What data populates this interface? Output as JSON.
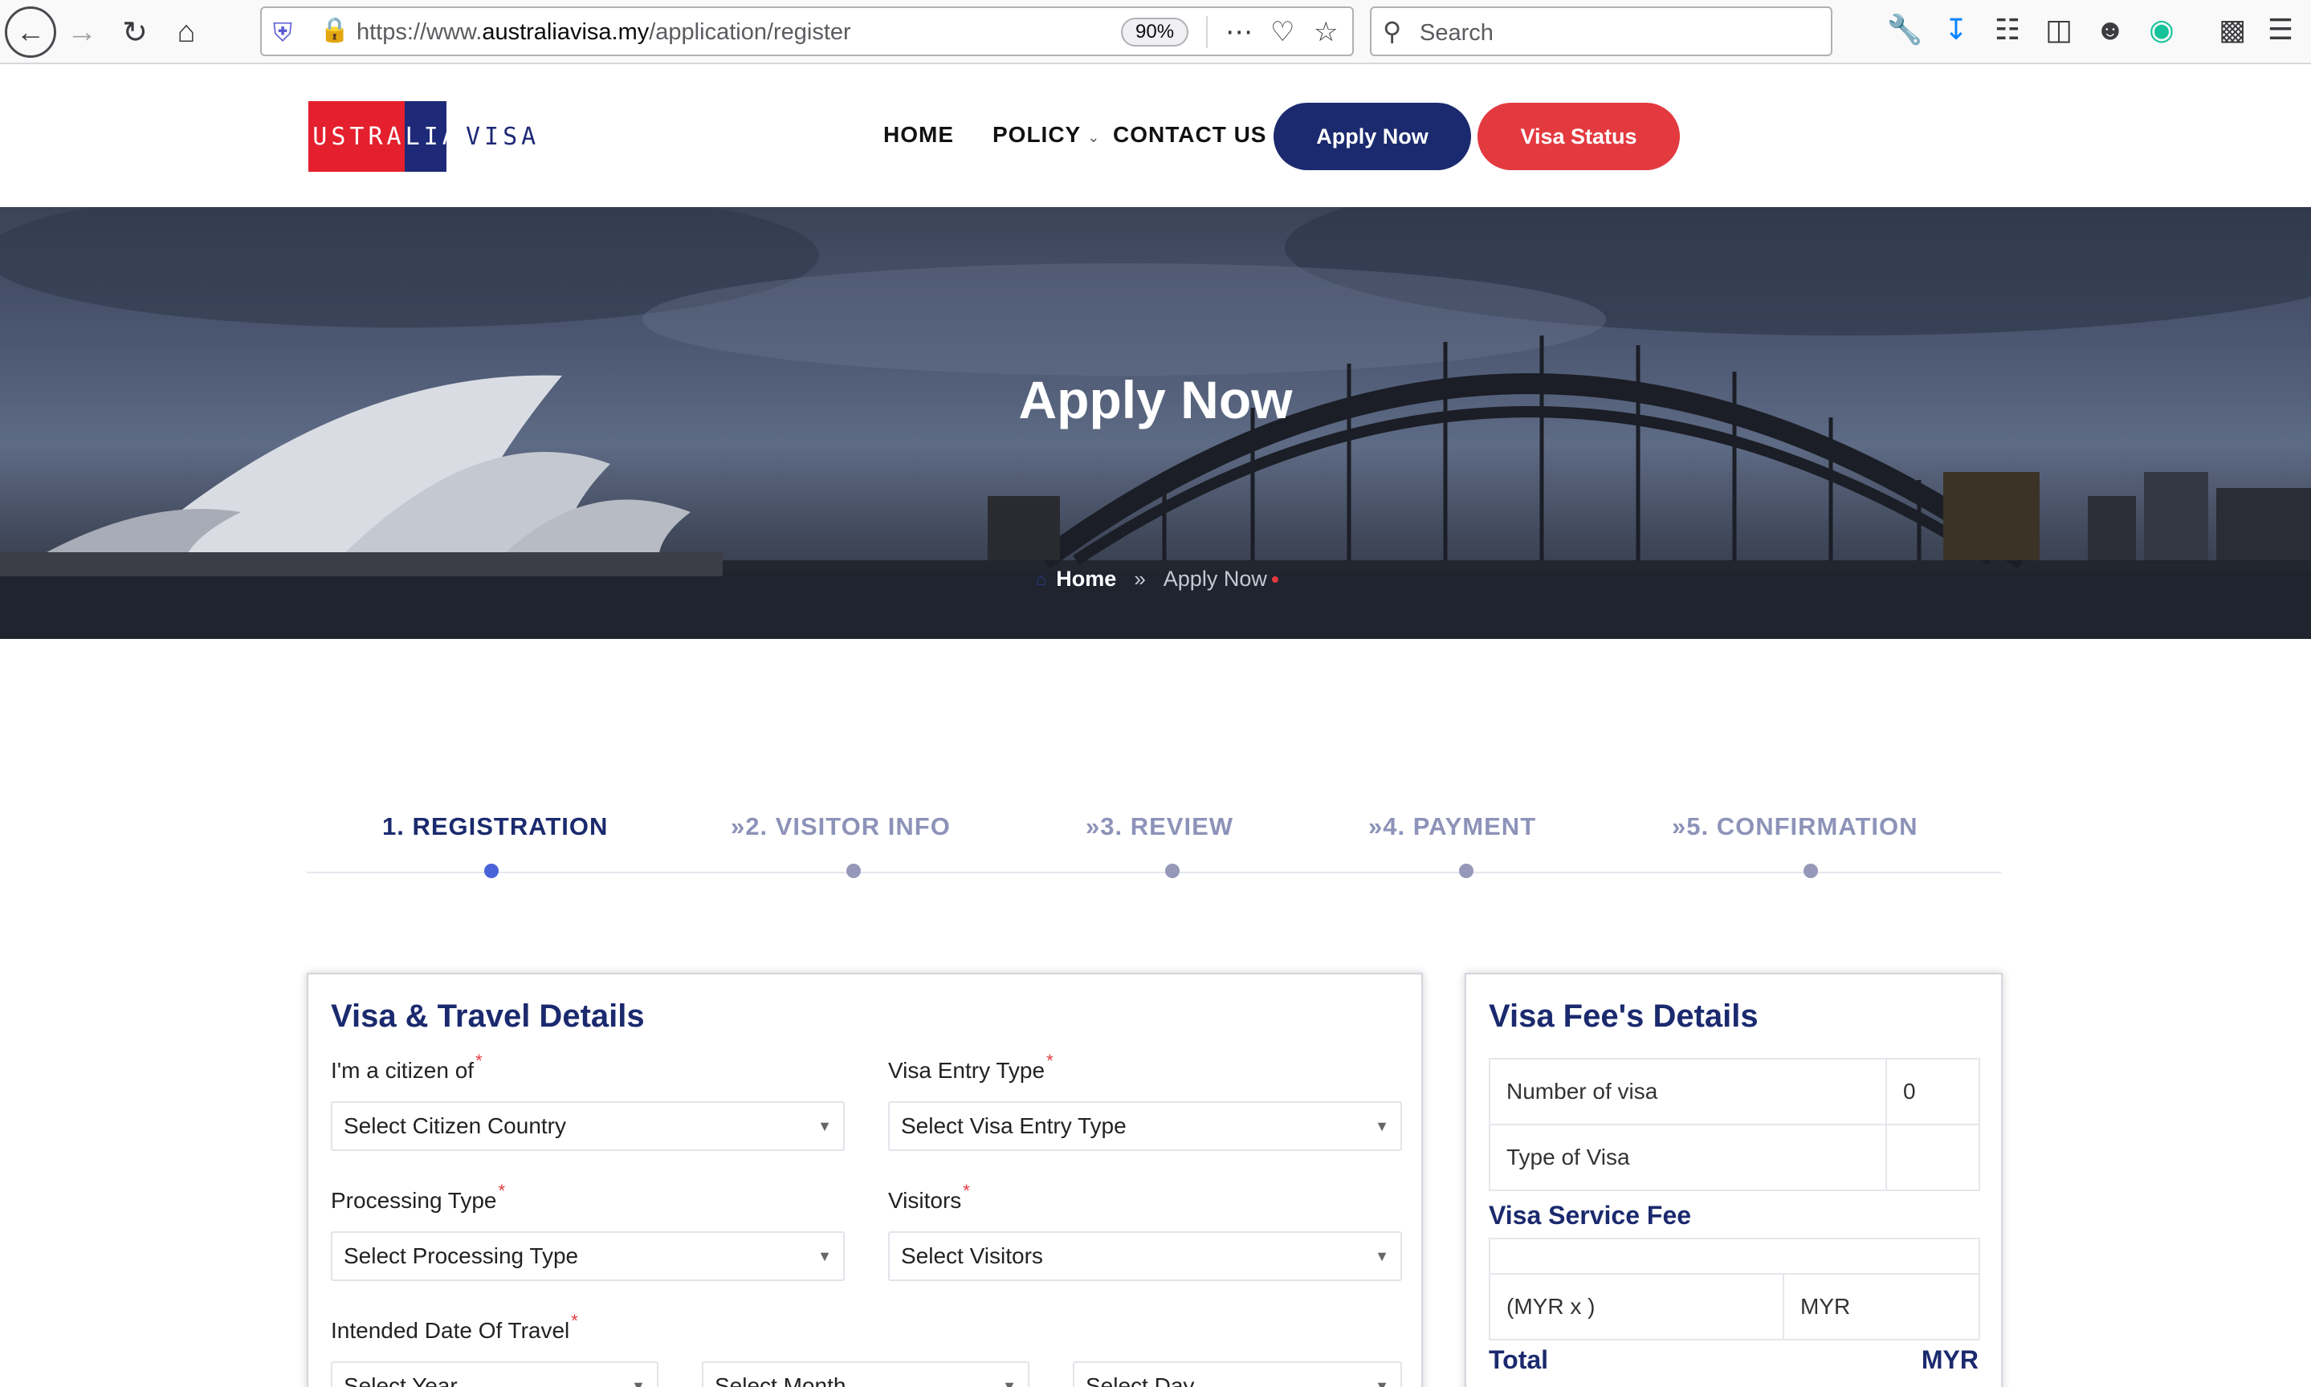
{
  "browser": {
    "url_prefix": "https://www.",
    "url_domain": "australiavisa.my",
    "url_path": "/application/register",
    "zoom": "90%",
    "search_placeholder": "Search"
  },
  "header": {
    "logo_left": "AUSTRALIA",
    "logo_right": "VISA",
    "nav": {
      "home": "HOME",
      "policy": "POLICY",
      "contact": "CONTACT US"
    },
    "apply_button": "Apply Now",
    "status_button": "Visa Status"
  },
  "hero": {
    "title": "Apply Now",
    "breadcrumb_home": "Home",
    "breadcrumb_current": "Apply Now"
  },
  "steps": [
    {
      "label": "1. REGISTRATION"
    },
    {
      "label": "2. VISITOR INFO"
    },
    {
      "label": "3. REVIEW"
    },
    {
      "label": "4. PAYMENT"
    },
    {
      "label": "5. CONFIRMATION"
    }
  ],
  "travel": {
    "title": "Visa & Travel Details",
    "citizen_label": "I'm a citizen of",
    "citizen_value": "Select Citizen Country",
    "entry_label": "Visa Entry Type",
    "entry_value": "Select Visa Entry Type",
    "processing_label": "Processing Type",
    "processing_value": "Select Processing Type",
    "visitors_label": "Visitors",
    "visitors_value": "Select Visitors",
    "date_label": "Intended Date Of Travel",
    "year_value": "Select Year",
    "month_value": "Select Month",
    "day_value": "Select Day"
  },
  "fees": {
    "title": "Visa Fee's Details",
    "number_label": "Number of visa",
    "number_value": "0",
    "type_label": "Type of Visa",
    "type_value": "",
    "service_title": "Visa Service Fee",
    "service_blank": "",
    "rate_label": "(MYR x )",
    "rate_value": "MYR",
    "total_label": "Total",
    "total_value": "MYR"
  },
  "colors": {
    "brand_navy": "#1b2a6e",
    "brand_red": "#e33a3f"
  }
}
